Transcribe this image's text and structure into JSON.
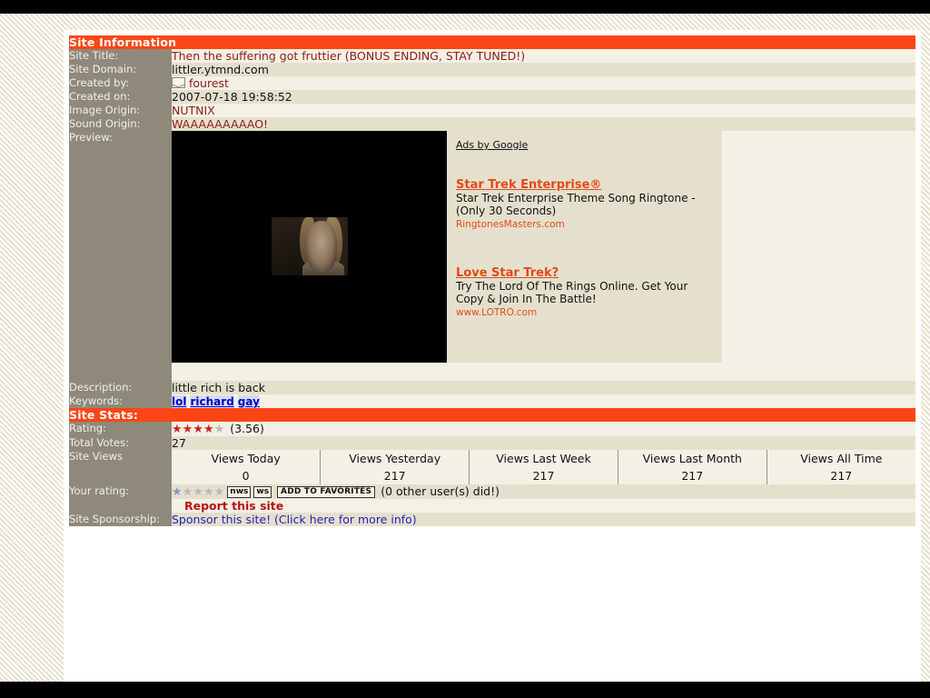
{
  "sections": {
    "info_header": "Site Information",
    "stats_header": "Site Stats:"
  },
  "info": {
    "site_title_label": "Site Title:",
    "site_title_value": "Then the suffering got fruttier (BONUS ENDING, STAY TUNED!)",
    "site_domain_label": "Site Domain:",
    "site_domain_value": "littler.ytmnd.com",
    "created_by_label": "Created by:",
    "created_by_value": "fourest",
    "created_by_icon": "mail-icon",
    "created_on_label": "Created on:",
    "created_on_value": "2007-07-18 19:58:52",
    "image_origin_label": "Image Origin:",
    "image_origin_value": "NUTNIX",
    "sound_origin_label": "Sound Origin:",
    "sound_origin_value": "WAAAAAAAAAO!",
    "preview_label": "Preview:",
    "description_label": "Description:",
    "description_value": "little rich is back",
    "keywords_label": "Keywords:",
    "keywords": [
      "lol",
      "richard",
      "gay"
    ]
  },
  "ads": {
    "ads_by_label": "Ads by Google",
    "items": [
      {
        "title": "Star Trek Enterprise®",
        "description": "Star Trek Enterprise Theme Song Ringtone - (Only 30 Seconds)",
        "url": "RingtonesMasters.com"
      },
      {
        "title": "Love Star Trek?",
        "description": "Try The Lord Of The Rings Online. Get Your Copy & Join In The Battle!",
        "url": "www.LOTRO.com"
      }
    ]
  },
  "stats": {
    "rating_label": "Rating:",
    "rating_value": "(3.56)",
    "rating_stars_filled": 4,
    "rating_stars_total": 5,
    "total_votes_label": "Total Votes:",
    "total_votes_value": "27",
    "site_views_label": "Site Views",
    "views_headers": [
      "Views Today",
      "Views Yesterday",
      "Views Last Week",
      "Views Last Month",
      "Views All Time"
    ],
    "views_values": [
      "0",
      "217",
      "217",
      "217",
      "217"
    ],
    "your_rating_label": "Your rating:",
    "your_rating_stars_filled": 1,
    "your_rating_stars_total": 5,
    "nws_button": "nws",
    "ws_button": "ws",
    "add_to_favorites_button": "ADD TO FAVORITES",
    "other_users_text": "(0 other user(s) did!)",
    "report_link": "Report this site",
    "sponsorship_label": "Site Sponsorship:",
    "sponsorship_link": "Sponsor this site! (Click here for more info)"
  },
  "colors": {
    "accent_orange": "#fa4616",
    "label_gray": "#8e897a",
    "row_light": "#f3f0e6",
    "row_dark": "#e5e0cd",
    "maroon": "#8c1c13",
    "link_blue": "#0000cc"
  }
}
